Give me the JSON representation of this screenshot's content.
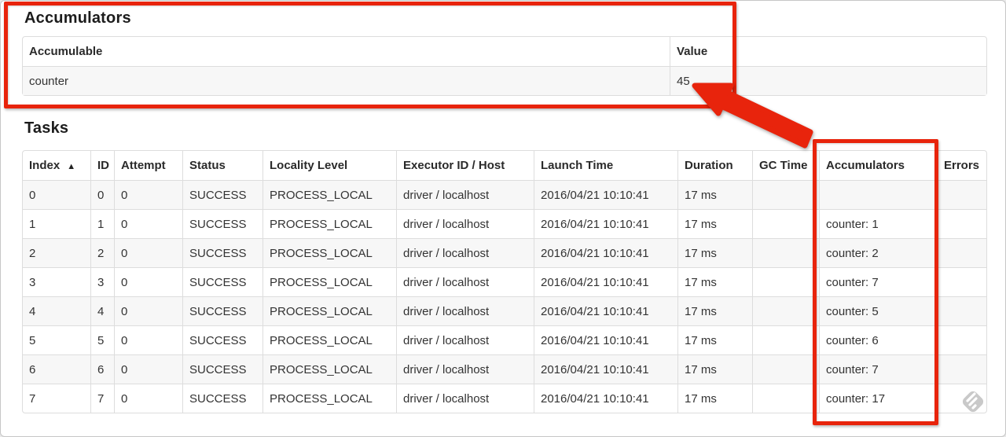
{
  "accumulators_section": {
    "title": "Accumulators",
    "headers": [
      "Accumulable",
      "Value"
    ],
    "rows": [
      {
        "accumulable": "counter",
        "value": "45"
      }
    ]
  },
  "tasks_section": {
    "title": "Tasks",
    "headers": [
      "Index",
      "ID",
      "Attempt",
      "Status",
      "Locality Level",
      "Executor ID / Host",
      "Launch Time",
      "Duration",
      "GC Time",
      "Accumulators",
      "Errors"
    ],
    "sort_indicator": "▲",
    "rows": [
      [
        "0",
        "0",
        "0",
        "SUCCESS",
        "PROCESS_LOCAL",
        "driver / localhost",
        "2016/04/21 10:10:41",
        "17 ms",
        "",
        "",
        ""
      ],
      [
        "1",
        "1",
        "0",
        "SUCCESS",
        "PROCESS_LOCAL",
        "driver / localhost",
        "2016/04/21 10:10:41",
        "17 ms",
        "",
        "counter: 1",
        ""
      ],
      [
        "2",
        "2",
        "0",
        "SUCCESS",
        "PROCESS_LOCAL",
        "driver / localhost",
        "2016/04/21 10:10:41",
        "17 ms",
        "",
        "counter: 2",
        ""
      ],
      [
        "3",
        "3",
        "0",
        "SUCCESS",
        "PROCESS_LOCAL",
        "driver / localhost",
        "2016/04/21 10:10:41",
        "17 ms",
        "",
        "counter: 7",
        ""
      ],
      [
        "4",
        "4",
        "0",
        "SUCCESS",
        "PROCESS_LOCAL",
        "driver / localhost",
        "2016/04/21 10:10:41",
        "17 ms",
        "",
        "counter: 5",
        ""
      ],
      [
        "5",
        "5",
        "0",
        "SUCCESS",
        "PROCESS_LOCAL",
        "driver / localhost",
        "2016/04/21 10:10:41",
        "17 ms",
        "",
        "counter: 6",
        ""
      ],
      [
        "6",
        "6",
        "0",
        "SUCCESS",
        "PROCESS_LOCAL",
        "driver / localhost",
        "2016/04/21 10:10:41",
        "17 ms",
        "",
        "counter: 7",
        ""
      ],
      [
        "7",
        "7",
        "0",
        "SUCCESS",
        "PROCESS_LOCAL",
        "driver / localhost",
        "2016/04/21 10:10:41",
        "17 ms",
        "",
        "counter: 17",
        ""
      ]
    ]
  },
  "annotations": {
    "highlight_color": "#e8240c",
    "boxed_regions": [
      "accumulators-summary-table",
      "tasks-accumulators-column"
    ],
    "arrow_points_to_value": "45"
  },
  "icons": {
    "sort": "sort-ascending-triangle",
    "watermark": "skitch-diamond-pencil"
  }
}
